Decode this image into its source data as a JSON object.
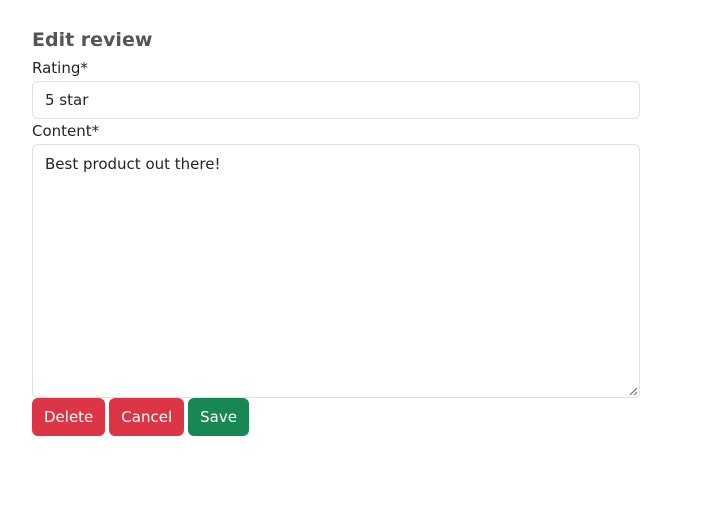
{
  "form": {
    "title": "Edit review",
    "rating_label": "Rating*",
    "rating_value": "5 star",
    "content_label": "Content*",
    "content_value": "Best product out there!"
  },
  "buttons": {
    "delete_label": "Delete",
    "cancel_label": "Cancel",
    "save_label": "Save"
  },
  "colors": {
    "danger": "#dc3545",
    "success": "#198754",
    "heading": "#555555",
    "border": "#dee2e6"
  }
}
